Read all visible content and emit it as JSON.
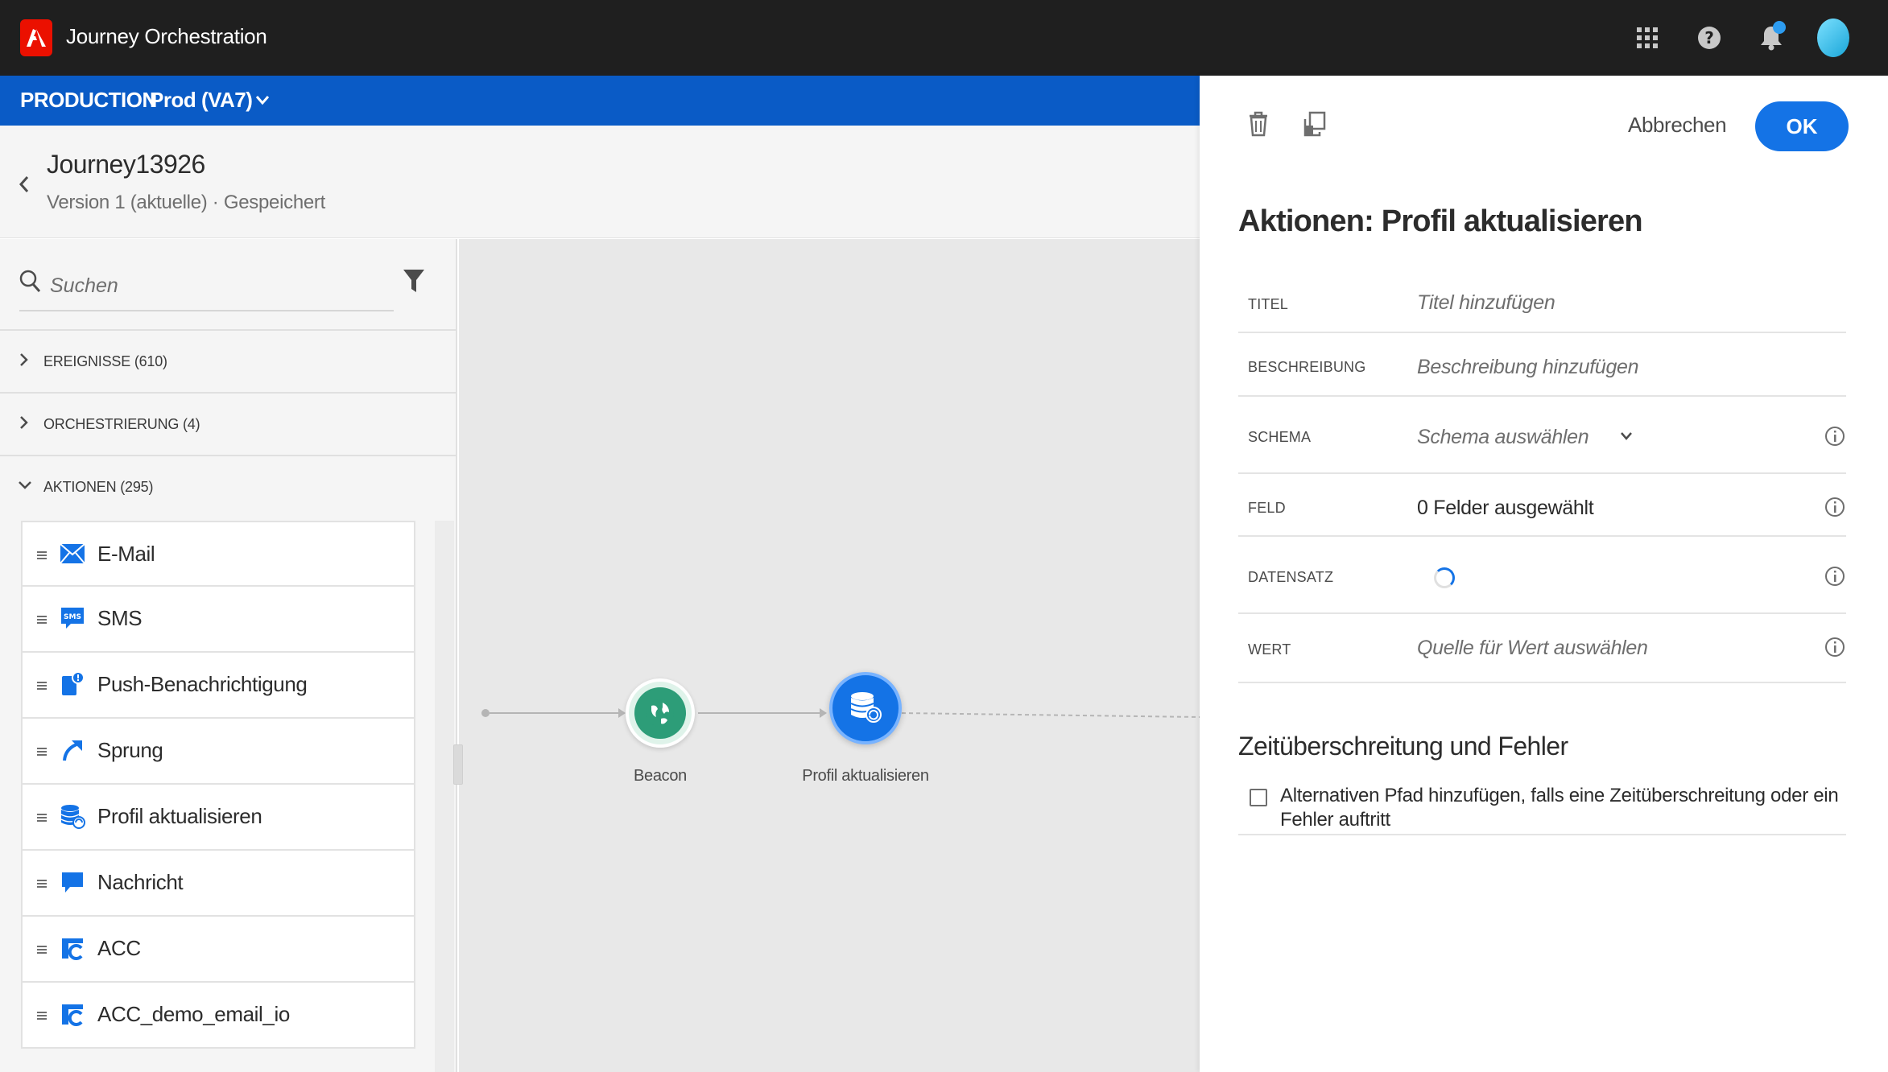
{
  "app": {
    "title": "Journey Orchestration",
    "brand_color": "#eb1000"
  },
  "topbar": {
    "icons": [
      "apps-grid-icon",
      "help-icon",
      "notifications-bell-icon",
      "user-avatar"
    ]
  },
  "env": {
    "label": "PRODUCTION",
    "sandbox": "Prod (VA7)",
    "color": "#0a5bc6"
  },
  "journey": {
    "name": "Journey13926",
    "version": "Version 1 (aktuelle) · Gespeichert"
  },
  "search": {
    "placeholder": "Suchen"
  },
  "categories": [
    {
      "label": "EREIGNISSE (610)",
      "expanded": false
    },
    {
      "label": "ORCHESTRIERUNG (4)",
      "expanded": false
    },
    {
      "label": "AKTIONEN (295)",
      "expanded": true
    }
  ],
  "actions": [
    {
      "label": "E-Mail",
      "icon": "email-icon"
    },
    {
      "label": "SMS",
      "icon": "sms-icon"
    },
    {
      "label": "Push-Benachrichtigung",
      "icon": "push-notification-icon"
    },
    {
      "label": "Sprung",
      "icon": "jump-arrow-icon"
    },
    {
      "label": "Profil aktualisieren",
      "icon": "update-profile-icon"
    },
    {
      "label": "Nachricht",
      "icon": "message-icon"
    },
    {
      "label": "ACC",
      "icon": "acc-icon"
    },
    {
      "label": "ACC_demo_email_io",
      "icon": "acc-icon"
    }
  ],
  "canvas": {
    "nodes": [
      {
        "label": "Beacon",
        "icon": "globe-icon"
      },
      {
        "label": "Profil aktualisieren",
        "icon": "update-profile-icon"
      }
    ]
  },
  "panel": {
    "cancel_label": "Abbrechen",
    "ok_label": "OK",
    "title": "Aktionen: Profil aktualisieren",
    "fields": [
      {
        "label": "TITEL",
        "value": "Titel hinzufügen",
        "is_placeholder": true
      },
      {
        "label": "BESCHREIBUNG",
        "value": "Beschreibung hinzufügen",
        "is_placeholder": true
      },
      {
        "label": "SCHEMA",
        "value": "Schema auswählen",
        "is_placeholder": true
      },
      {
        "label": "FELD",
        "value": "0 Felder ausgewählt",
        "is_placeholder": false
      },
      {
        "label": "DATENSATZ",
        "value": "",
        "loading": true
      },
      {
        "label": "WERT",
        "value": "Quelle für Wert auswählen",
        "is_placeholder": true
      }
    ],
    "timeout_title": "Zeitüberschreitung und Fehler",
    "timeout_checkbox_label": "Alternativen Pfad hinzufügen, falls eine Zeitüberschreitung oder ein Fehler auftritt",
    "timeout_checked": false,
    "accent_color": "#1473e6"
  }
}
